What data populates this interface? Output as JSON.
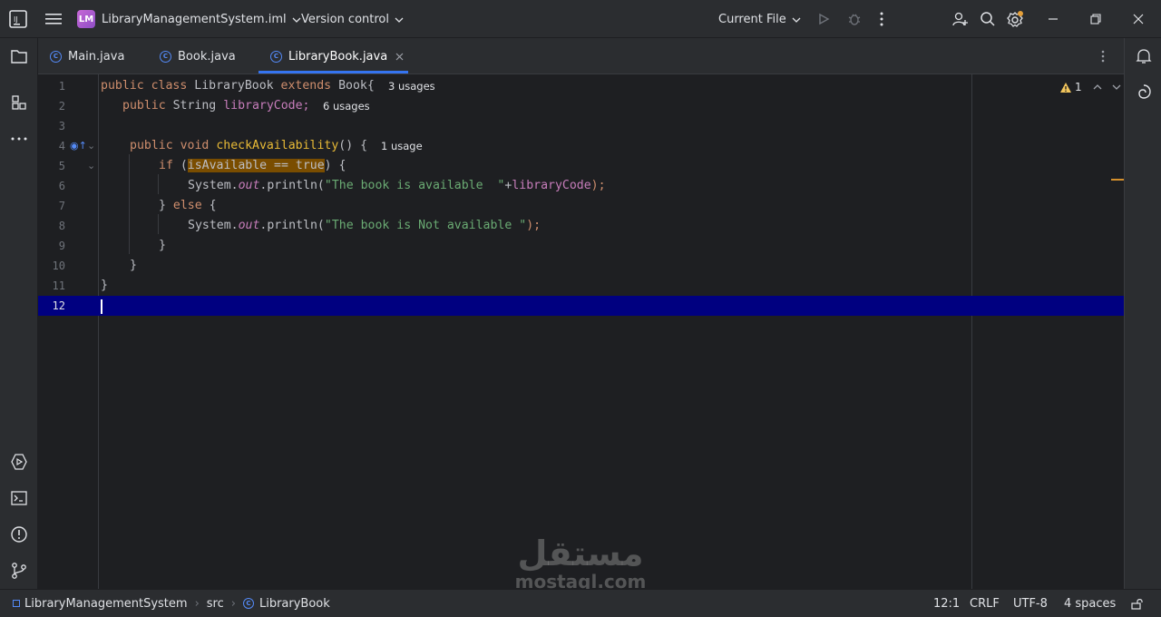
{
  "titlebar": {
    "project_badge": "LM",
    "project_name": "LibraryManagementSystem.iml",
    "vcs": "Version control",
    "run_config": "Current File"
  },
  "tabs": [
    {
      "label": "Main.java"
    },
    {
      "label": "Book.java"
    },
    {
      "label": "LibraryBook.java"
    }
  ],
  "editor": {
    "line_numbers": [
      "1",
      "2",
      "3",
      "4",
      "5",
      "6",
      "7",
      "8",
      "9",
      "10",
      "11",
      "12"
    ],
    "warnings_count": "1",
    "lines": {
      "l1": {
        "kw1": "public",
        "kw2": "class",
        "name": "LibraryBook",
        "kw3": "extends",
        "parent": "Book{",
        "hint": "3 usages"
      },
      "l2": {
        "kw1": "public",
        "type": "String",
        "field": "libraryCode;",
        "hint": "6 usages"
      },
      "l4": {
        "kw1": "public",
        "kw2": "void",
        "method": "checkAvailability",
        "rest": "() {",
        "hint": "1 usage"
      },
      "l5": {
        "kw": "if",
        "open": " (",
        "cond": "isAvailable == true",
        "close": ") {"
      },
      "l6": {
        "obj": "System.",
        "out": "out",
        "call": ".println(",
        "str": "\"The book is available  \"",
        "plus": "+",
        "field": "libraryCode",
        "end": ");"
      },
      "l7": {
        "close": "} ",
        "kw": "else",
        "open": " {"
      },
      "l8": {
        "obj": "System.",
        "out": "out",
        "call": ".println(",
        "str": "\"The book is Not available \"",
        "end": ");"
      },
      "l9": {
        "text": "}"
      },
      "l10": {
        "text": "}"
      },
      "l11": {
        "text": "}"
      }
    }
  },
  "statusbar": {
    "breadcrumb": [
      "LibraryManagementSystem",
      "src",
      "LibraryBook"
    ],
    "position": "12:1",
    "line_sep": "CRLF",
    "encoding": "UTF-8",
    "indent": "4 spaces"
  },
  "watermark": {
    "arabic": "مستقل",
    "latin": "mostaql.com"
  },
  "colors": {
    "accent": "#3574f0",
    "keyword": "#cf8e6d",
    "string": "#6aab73",
    "field": "#c77dbb",
    "current_line": "#000080"
  }
}
